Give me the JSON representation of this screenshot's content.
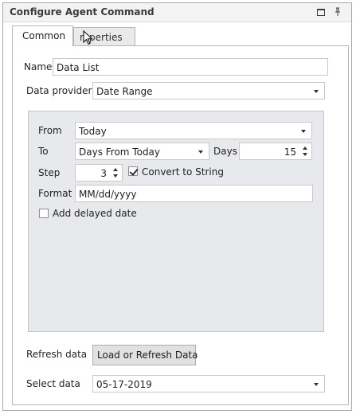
{
  "panel": {
    "title": "Configure Agent Command",
    "restore_icon": "restore-icon",
    "pin_icon": "pin-icon"
  },
  "tabs": [
    {
      "label": "Common",
      "active": true
    },
    {
      "label": "roperties",
      "active": false
    }
  ],
  "form": {
    "name_label": "Name",
    "name_value": "Data List",
    "provider_label": "Data provider",
    "provider_value": "Date Range"
  },
  "range": {
    "from_label": "From",
    "from_value": "Today",
    "to_label": "To",
    "to_value": "Days From Today",
    "days_label": "Days",
    "days_value": "15",
    "step_label": "Step",
    "step_value": "3",
    "convert_label": "Convert to String",
    "convert_checked": true,
    "format_label": "Format",
    "format_value": "MM/dd/yyyy",
    "delayed_label": "Add delayed date",
    "delayed_checked": false
  },
  "refresh": {
    "label": "Refresh data",
    "button_label": "Load or Refresh Data"
  },
  "select": {
    "label": "Select data",
    "value": "05-17-2019"
  },
  "colors": {
    "group_bg": "#e8e9ed",
    "button_bg": "#e1e1e1"
  }
}
